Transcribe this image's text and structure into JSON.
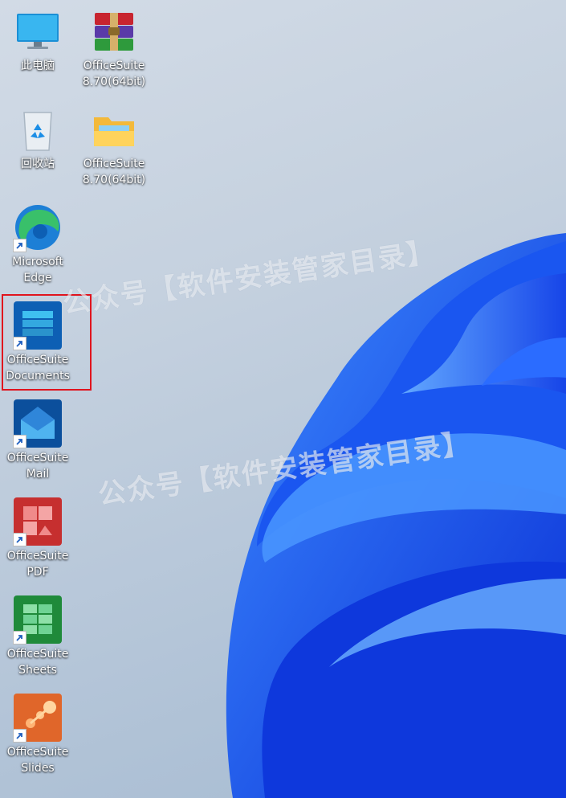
{
  "desktop": {
    "icons": [
      {
        "label": "此电脑",
        "icon": "computer-icon"
      },
      {
        "label": "OfficeSuite\n8.70(64bit)",
        "icon": "archive-icon"
      },
      {
        "label": "回收站",
        "icon": "recycle-bin-icon"
      },
      {
        "label": "OfficeSuite\n8.70(64bit)",
        "icon": "folder-icon"
      },
      {
        "label": "Microsoft\nEdge",
        "icon": "edge-icon"
      },
      {
        "label": "OfficeSuite\nDocuments",
        "icon": "officesuite-documents-icon"
      },
      {
        "label": "OfficeSuite\nMail",
        "icon": "officesuite-mail-icon"
      },
      {
        "label": "OfficeSuite\nPDF",
        "icon": "officesuite-pdf-icon"
      },
      {
        "label": "OfficeSuite\nSheets",
        "icon": "officesuite-sheets-icon"
      },
      {
        "label": "OfficeSuite\nSlides",
        "icon": "officesuite-slides-icon"
      }
    ],
    "watermark_top": "公众号【软件安装管家目录】",
    "watermark_bottom": "公众号【软件安装管家目录】",
    "highlight_color": "#e0141e"
  }
}
